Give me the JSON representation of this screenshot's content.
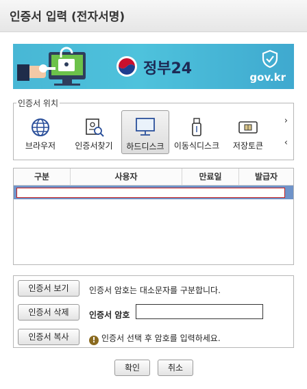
{
  "window": {
    "title": "인증서 입력 (전자서명)"
  },
  "banner": {
    "logo_text": "정부24",
    "site": "gov.kr"
  },
  "location": {
    "legend": "인증서 위치",
    "items": [
      {
        "label": "브라우저",
        "icon": "globe-icon"
      },
      {
        "label": "인증서찾기",
        "icon": "certificate-search-icon"
      },
      {
        "label": "하드디스크",
        "icon": "monitor-icon",
        "selected": true
      },
      {
        "label": "이동식디스크",
        "icon": "usb-icon"
      },
      {
        "label": "저장토큰",
        "icon": "token-icon"
      }
    ],
    "next_arrow": "›",
    "prev_arrow": "‹"
  },
  "table": {
    "columns": [
      "구분",
      "사용자",
      "만료일",
      "발급자"
    ]
  },
  "panel": {
    "view_button": "인증서 보기",
    "delete_button": "인증서 삭제",
    "copy_button": "인증서 복사",
    "notice": "인증서 암호는 대소문자를 구분합니다.",
    "password_label": "인증서 암호",
    "password_value": "",
    "hint": "인증서 선택 후 암호를 입력하세요."
  },
  "footer": {
    "ok_button": "확인",
    "cancel_button": "취소"
  },
  "colors": {
    "selected_row": "#6f93c9",
    "banner": "#48b7d5",
    "warn": "#8a6a20"
  }
}
